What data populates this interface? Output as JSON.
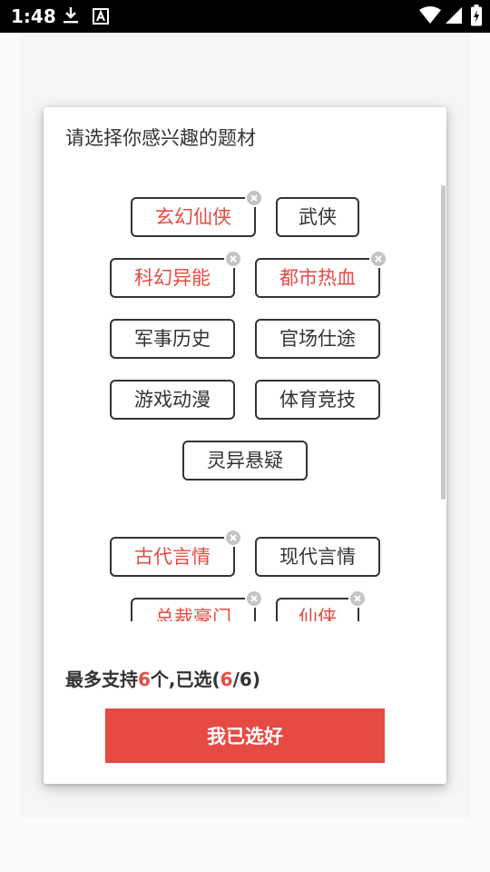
{
  "status_bar": {
    "time": "1:48"
  },
  "dialog": {
    "title": "请选择你感兴趣的题材",
    "tags": [
      {
        "label": "玄幻仙侠",
        "selected": true
      },
      {
        "label": "武侠",
        "selected": false
      },
      {
        "label": "科幻异能",
        "selected": true
      },
      {
        "label": "都市热血",
        "selected": true
      },
      {
        "label": "军事历史",
        "selected": false
      },
      {
        "label": "官场仕途",
        "selected": false
      },
      {
        "label": "游戏动漫",
        "selected": false
      },
      {
        "label": "体育竞技",
        "selected": false
      },
      {
        "label": "灵异悬疑",
        "selected": false
      },
      {
        "label": "古代言情",
        "selected": true
      },
      {
        "label": "现代言情",
        "selected": false
      },
      {
        "label": "总裁豪门",
        "selected": true
      },
      {
        "label": "仙侠",
        "selected": true
      }
    ],
    "count": {
      "prefix": "最多支持",
      "max": "6",
      "mid": "个,已选(",
      "selected": "6",
      "sep": "/",
      "total": "6",
      "suffix": ")"
    },
    "confirm_label": "我已选好"
  },
  "colors": {
    "accent": "#e64a42",
    "text": "#333333",
    "badge": "#c4c4c4"
  }
}
